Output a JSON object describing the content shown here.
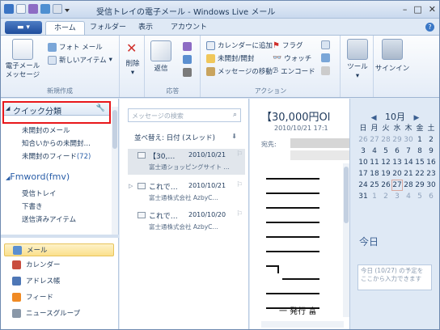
{
  "window": {
    "title": "受信トレイの電子メール - Windows Live メール"
  },
  "tabs": [
    {
      "label": "ホーム",
      "active": true
    },
    {
      "label": "フォルダー",
      "active": false
    },
    {
      "label": "表示",
      "active": false
    },
    {
      "label": "アカウント",
      "active": false
    }
  ],
  "ribbon": {
    "new_group": {
      "email": "電子メール\nメッセージ",
      "photo": "フォト メール",
      "new_items": "新しいアイテム",
      "label": "新規作成"
    },
    "delete_group": {
      "delete": "削除"
    },
    "respond_group": {
      "reply": "返信",
      "label": "応答"
    },
    "actions_group": {
      "add_calendar": "カレンダーに追加",
      "flag": "フラグ",
      "unread": "未開封/開封",
      "watch": "ウォッチ",
      "move": "メッセージの移動",
      "encode": "エンコード",
      "label": "アクション"
    },
    "tools": {
      "tools": "ツール",
      "signin": "サインイン"
    }
  },
  "folders": {
    "quick_views": "クイック分類",
    "items": [
      {
        "label": "未開封のメール"
      },
      {
        "label": "知合いからの未開封…"
      },
      {
        "label": "未開封のフィード",
        "count": "(72)"
      }
    ],
    "account": "Fmword(fmv)",
    "account_items": [
      {
        "label": "受信トレイ"
      },
      {
        "label": "下書き"
      },
      {
        "label": "送信済みアイテム"
      }
    ]
  },
  "nav": [
    {
      "label": "メール",
      "active": true
    },
    {
      "label": "カレンダー",
      "active": false
    },
    {
      "label": "アドレス帳",
      "active": false
    },
    {
      "label": "フィード",
      "active": false
    },
    {
      "label": "ニュースグループ",
      "active": false
    }
  ],
  "message_list": {
    "search_placeholder": "メッセージの検索",
    "sort_label": "並べ替え: 日付 (スレッド)",
    "messages": [
      {
        "subject": "【30,…",
        "date": "2010/10/21",
        "from": "富士通ショッピングサイト …",
        "selected": true
      },
      {
        "subject": "これで…",
        "date": "2010/10/21",
        "from": "富士通株式会社 AzbyC…",
        "selected": false
      },
      {
        "subject": "これで…",
        "date": "2010/10/20",
        "from": "富士通株式会社 AzbyC…",
        "selected": false
      }
    ]
  },
  "reading": {
    "title": "【30,000円Ol",
    "date": "2010/10/21 17:1",
    "from_label": "宛先:",
    "footer_text": "一   発行 富"
  },
  "calendar": {
    "month": "10月",
    "weekdays": [
      "日",
      "月",
      "火",
      "水",
      "木",
      "金",
      "土"
    ],
    "weeks": [
      [
        "26",
        "27",
        "28",
        "29",
        "30",
        "1",
        "2"
      ],
      [
        "3",
        "4",
        "5",
        "6",
        "7",
        "8",
        "9"
      ],
      [
        "10",
        "11",
        "12",
        "13",
        "14",
        "15",
        "16"
      ],
      [
        "17",
        "18",
        "19",
        "20",
        "21",
        "22",
        "23"
      ],
      [
        "24",
        "25",
        "26",
        "27",
        "28",
        "29",
        "30"
      ],
      [
        "31",
        "1",
        "2",
        "3",
        "4",
        "5",
        "6"
      ]
    ],
    "today_label": "今日",
    "today_placeholder": "今日 (10/27) の予定をここから入力できます"
  }
}
